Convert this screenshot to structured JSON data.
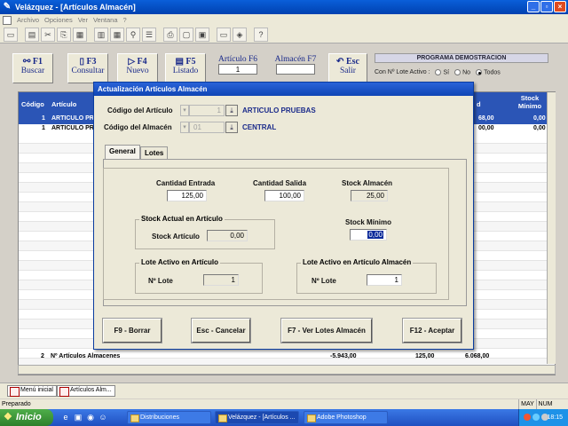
{
  "window": {
    "title": "Velázquez - [Artículos Almacén]",
    "buttons": [
      "_",
      "▫",
      "×"
    ]
  },
  "menu": [
    "Archivo",
    "Opciones",
    "Ver",
    "Ventana",
    "?"
  ],
  "actionbar": {
    "buscar": {
      "key": "F1",
      "label": "Buscar"
    },
    "consultar": {
      "key": "F3",
      "label": "Consultar"
    },
    "nuevo": {
      "key": "F4",
      "label": "Nuevo"
    },
    "listado": {
      "key": "F5",
      "label": "Listado"
    },
    "articulo": {
      "label": "Artículo F6",
      "value": "1"
    },
    "almacen": {
      "label": "Almacén F7",
      "value": ""
    },
    "salir": {
      "key": "Esc",
      "label": "Salir"
    },
    "demo_title": "PROGRAMA DEMOSTRACION",
    "lote_label": "Con Nº Lote Activo :",
    "radio_si": "Sí",
    "radio_no": "No",
    "radio_todos": "Todos",
    "radio_selected": "Todos"
  },
  "grid": {
    "headers": {
      "codigo": "Código",
      "articulo": "Artículo",
      "col_d": "d",
      "stock_minimo": "Stock Mínimo"
    },
    "rows": [
      {
        "codigo": "1",
        "articulo": "ARTICULO PR",
        "stock": "68,00",
        "minimo": "0,00",
        "selected": true
      },
      {
        "codigo": "1",
        "articulo": "ARTICULO PR",
        "stock": "00,00",
        "minimo": "0,00",
        "selected": false
      }
    ],
    "footer": {
      "count": "2",
      "label": "Nº Artículos Almacenes",
      "total1": "-5.943,00",
      "total2": "125,00",
      "total3": "6.068,00"
    }
  },
  "dialog": {
    "title": "Actualización Artículos Almacén",
    "codigo_articulo_label": "Código del Artículo",
    "codigo_articulo_value": "1",
    "articulo_name": "ARTICULO PRUEBAS",
    "codigo_almacen_label": "Código del Almacén",
    "codigo_almacen_value": "01",
    "almacen_name": "CENTRAL",
    "tabs": [
      "General",
      "Lotes"
    ],
    "cantidad_entrada_label": "Cantidad Entrada",
    "cantidad_entrada": "125,00",
    "cantidad_salida_label": "Cantidad Salida",
    "cantidad_salida": "100,00",
    "stock_almacen_label": "Stock Almacén",
    "stock_almacen": "25,00",
    "stock_actual_group": "Stock Actual en Artículo",
    "stock_articulo_label": "Stock Artículo",
    "stock_articulo": "0,00",
    "stock_minimo_label": "Stock Mínimo",
    "stock_minimo": "0,00",
    "lote_articulo_group": "Lote Activo en Artículo",
    "nlote_label_1": "Nº Lote",
    "nlote_1": "1",
    "lote_almacen_group": "Lote Activo en Artículo Almacén",
    "nlote_label_2": "Nº Lote",
    "nlote_2": "1",
    "btn_borrar": "F9 - Borrar",
    "btn_cancelar": "Esc - Cancelar",
    "btn_ver_lotes": "F7 - Ver Lotes Almacén",
    "btn_aceptar": "F12 - Aceptar"
  },
  "mditabs": [
    "Menú inicial",
    "Artículos Alm..."
  ],
  "status": {
    "text": "Preparado",
    "may": "MAY",
    "num": "NUM"
  },
  "taskbar": {
    "start": "Inicio",
    "items": [
      "Distribuciones",
      "Velázquez - [Artículos ...",
      "Adobe Photoshop"
    ],
    "clock": "18:15"
  },
  "colors": {
    "titlebar": "#0a5fd9",
    "grid_header": "#2b55b6",
    "taskbar": "#3b79e6",
    "start": "#4fae4a",
    "label_blue": "#1a2a8a"
  }
}
